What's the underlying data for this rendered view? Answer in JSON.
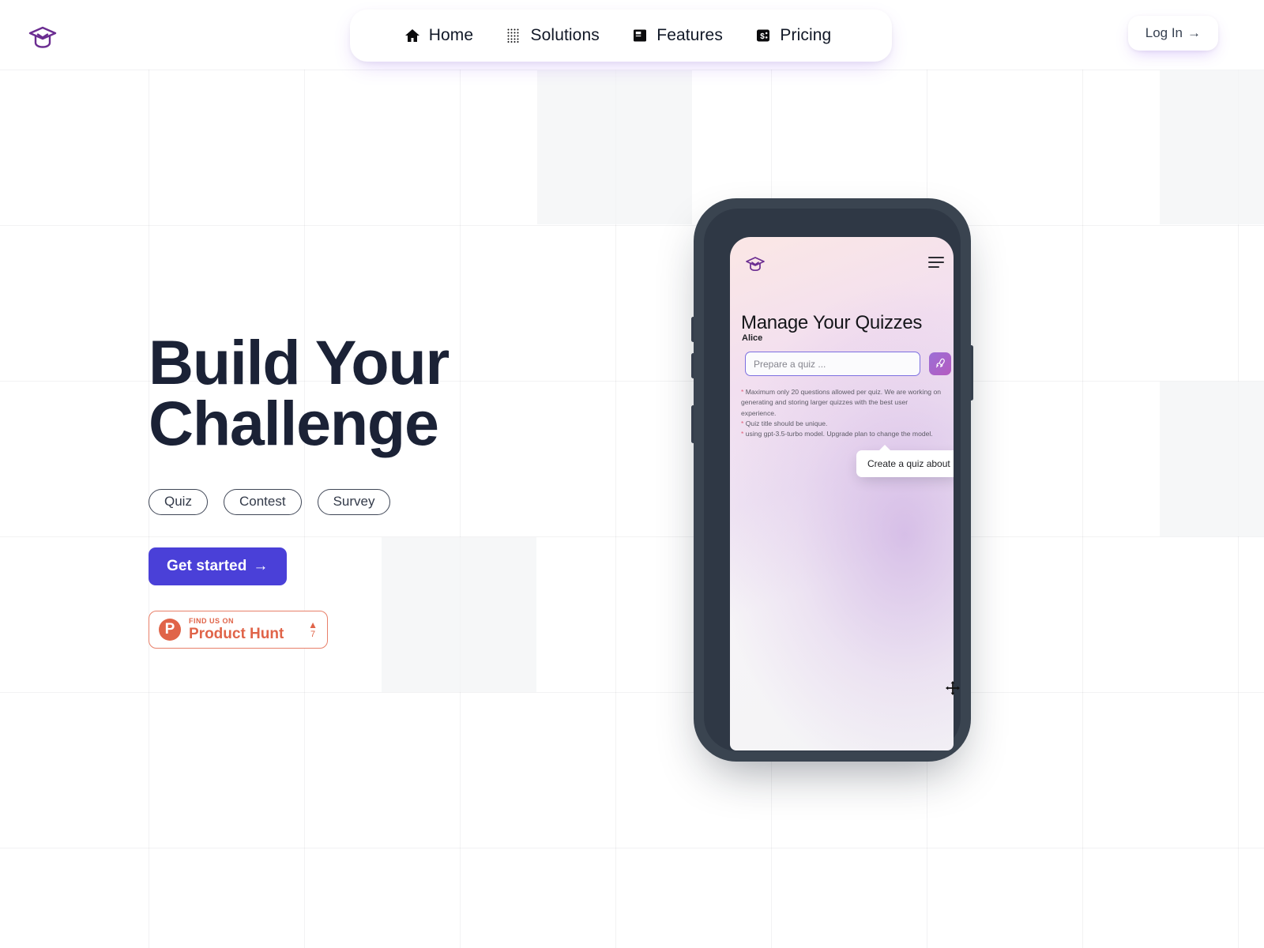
{
  "brand": {
    "logo_icon": "graduation-cap-icon",
    "logo_color": "#6b2d91"
  },
  "header": {
    "nav": [
      {
        "label": "Home",
        "icon": "home-icon"
      },
      {
        "label": "Solutions",
        "icon": "grid-dots-icon"
      },
      {
        "label": "Features",
        "icon": "book-icon"
      },
      {
        "label": "Pricing",
        "icon": "money-card-icon"
      }
    ],
    "login_label": "Log In",
    "login_arrow": "→"
  },
  "hero": {
    "title_line1": "Build Your",
    "title_line2": "Challenge",
    "pills": [
      "Quiz",
      "Contest",
      "Survey"
    ],
    "cta_label": "Get started",
    "cta_arrow": "→",
    "cta_color": "#4a40d8",
    "product_hunt": {
      "eyebrow": "FIND US ON",
      "name": "Product Hunt",
      "letter": "P",
      "caret": "▲",
      "votes": "7",
      "color": "#e06449"
    }
  },
  "phone": {
    "app_logo_icon": "graduation-cap-icon",
    "menu_icon": "hamburger-menu-icon",
    "title": "Manage Your Quizzes",
    "user": "Alice",
    "input_placeholder": "Prepare a quiz ...",
    "input_value": "",
    "submit_icon": "rocket-icon",
    "notes": [
      "* Maximum only 20 questions allowed per quiz. We are working on generating and storing larger quizzes with the best user experience.",
      "* Quiz title should be unique.",
      "* using gpt-3.5-turbo model. Upgrade plan to change the model."
    ],
    "tooltip": "Create a quiz about"
  },
  "cursor": {
    "icon": "move-cursor-icon"
  }
}
